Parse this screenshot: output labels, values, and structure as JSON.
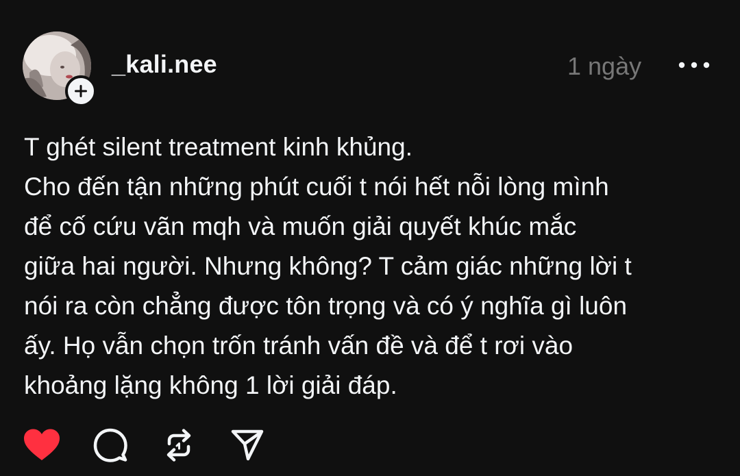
{
  "post": {
    "author": {
      "username": "_kali.nee",
      "follow_label": "+"
    },
    "timestamp": "1 ngày",
    "more_label": "•••",
    "lines": [
      "T ghét silent treatment kinh khủng.",
      "Cho đến tận những phút cuối t nói hết nỗi lòng mình",
      "để cố cứu vãn mqh và muốn giải quyết khúc mắc",
      "giữa hai người. Nhưng không? T cảm giác những lời t",
      "nói ra còn chẳng được tôn trọng và có ý nghĩa gì luôn",
      "ấy. Họ vẫn chọn trốn tránh vấn đề và để t rơi vào",
      "khoảng lặng không 1 lời giải đáp."
    ],
    "actions": {
      "like": {
        "icon": "heart-icon",
        "liked": true,
        "color": "#ff3040"
      },
      "reply": {
        "icon": "comment-icon"
      },
      "repost": {
        "icon": "repost-icon"
      },
      "share": {
        "icon": "send-icon"
      }
    }
  },
  "colors": {
    "background": "#101010",
    "text": "#f3f5f7",
    "muted": "#777777",
    "like": "#ff3040"
  }
}
